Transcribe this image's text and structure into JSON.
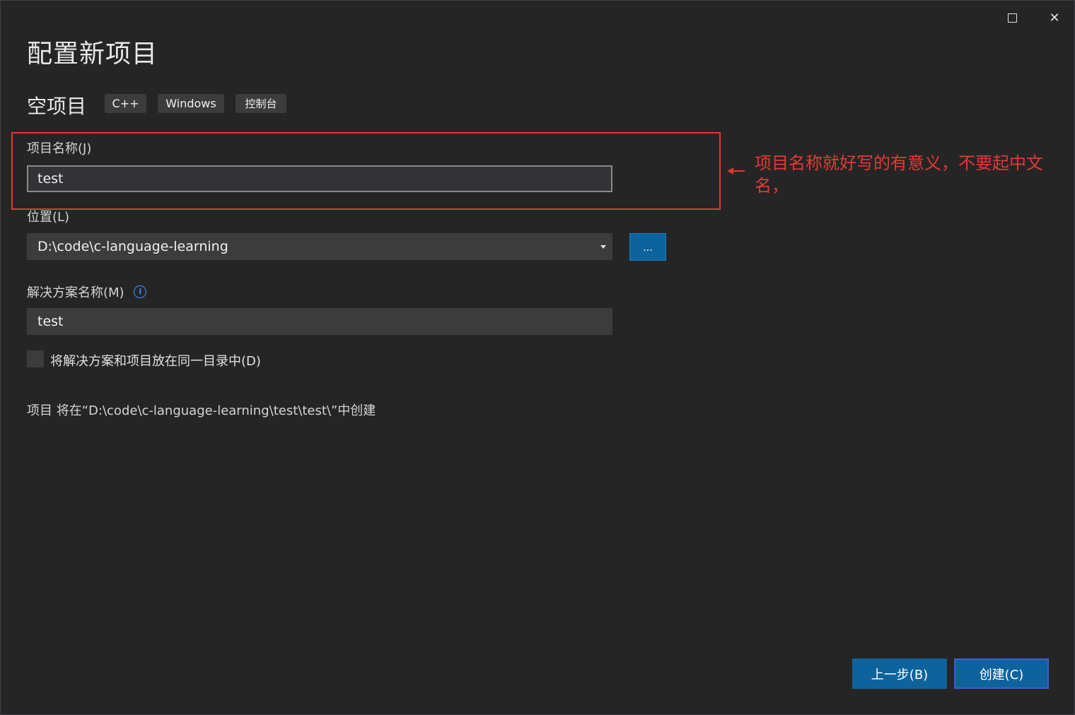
{
  "window": {
    "maximize_icon": "maximize-icon",
    "close_icon": "close-icon",
    "close_glyph": "✕"
  },
  "header": {
    "title": "配置新项目",
    "template_name": "空项目",
    "tags": [
      "C++",
      "Windows",
      "控制台"
    ]
  },
  "form": {
    "project_name": {
      "label": "项目名称(J)",
      "value": "test"
    },
    "location": {
      "label": "位置(L)",
      "value": "D:\\code\\c-language-learning",
      "browse_label": "..."
    },
    "solution_name": {
      "label": "解决方案名称(M)",
      "value": "test",
      "info_glyph": "i"
    },
    "same_dir_checkbox": {
      "label": "将解决方案和项目放在同一目录中(D)",
      "checked": false
    },
    "create_path_text": "项目 将在“D:\\code\\c-language-learning\\test\\test\\”中创建"
  },
  "annotation": {
    "text": "项目名称就好写的有意义，不要起中文名，",
    "color": "#e53935"
  },
  "footer": {
    "back_label": "上一步(B)",
    "create_label": "创建(C)"
  },
  "colors": {
    "background": "#252526",
    "accent": "#0e639c",
    "field_bg": "#3c3c3c"
  }
}
